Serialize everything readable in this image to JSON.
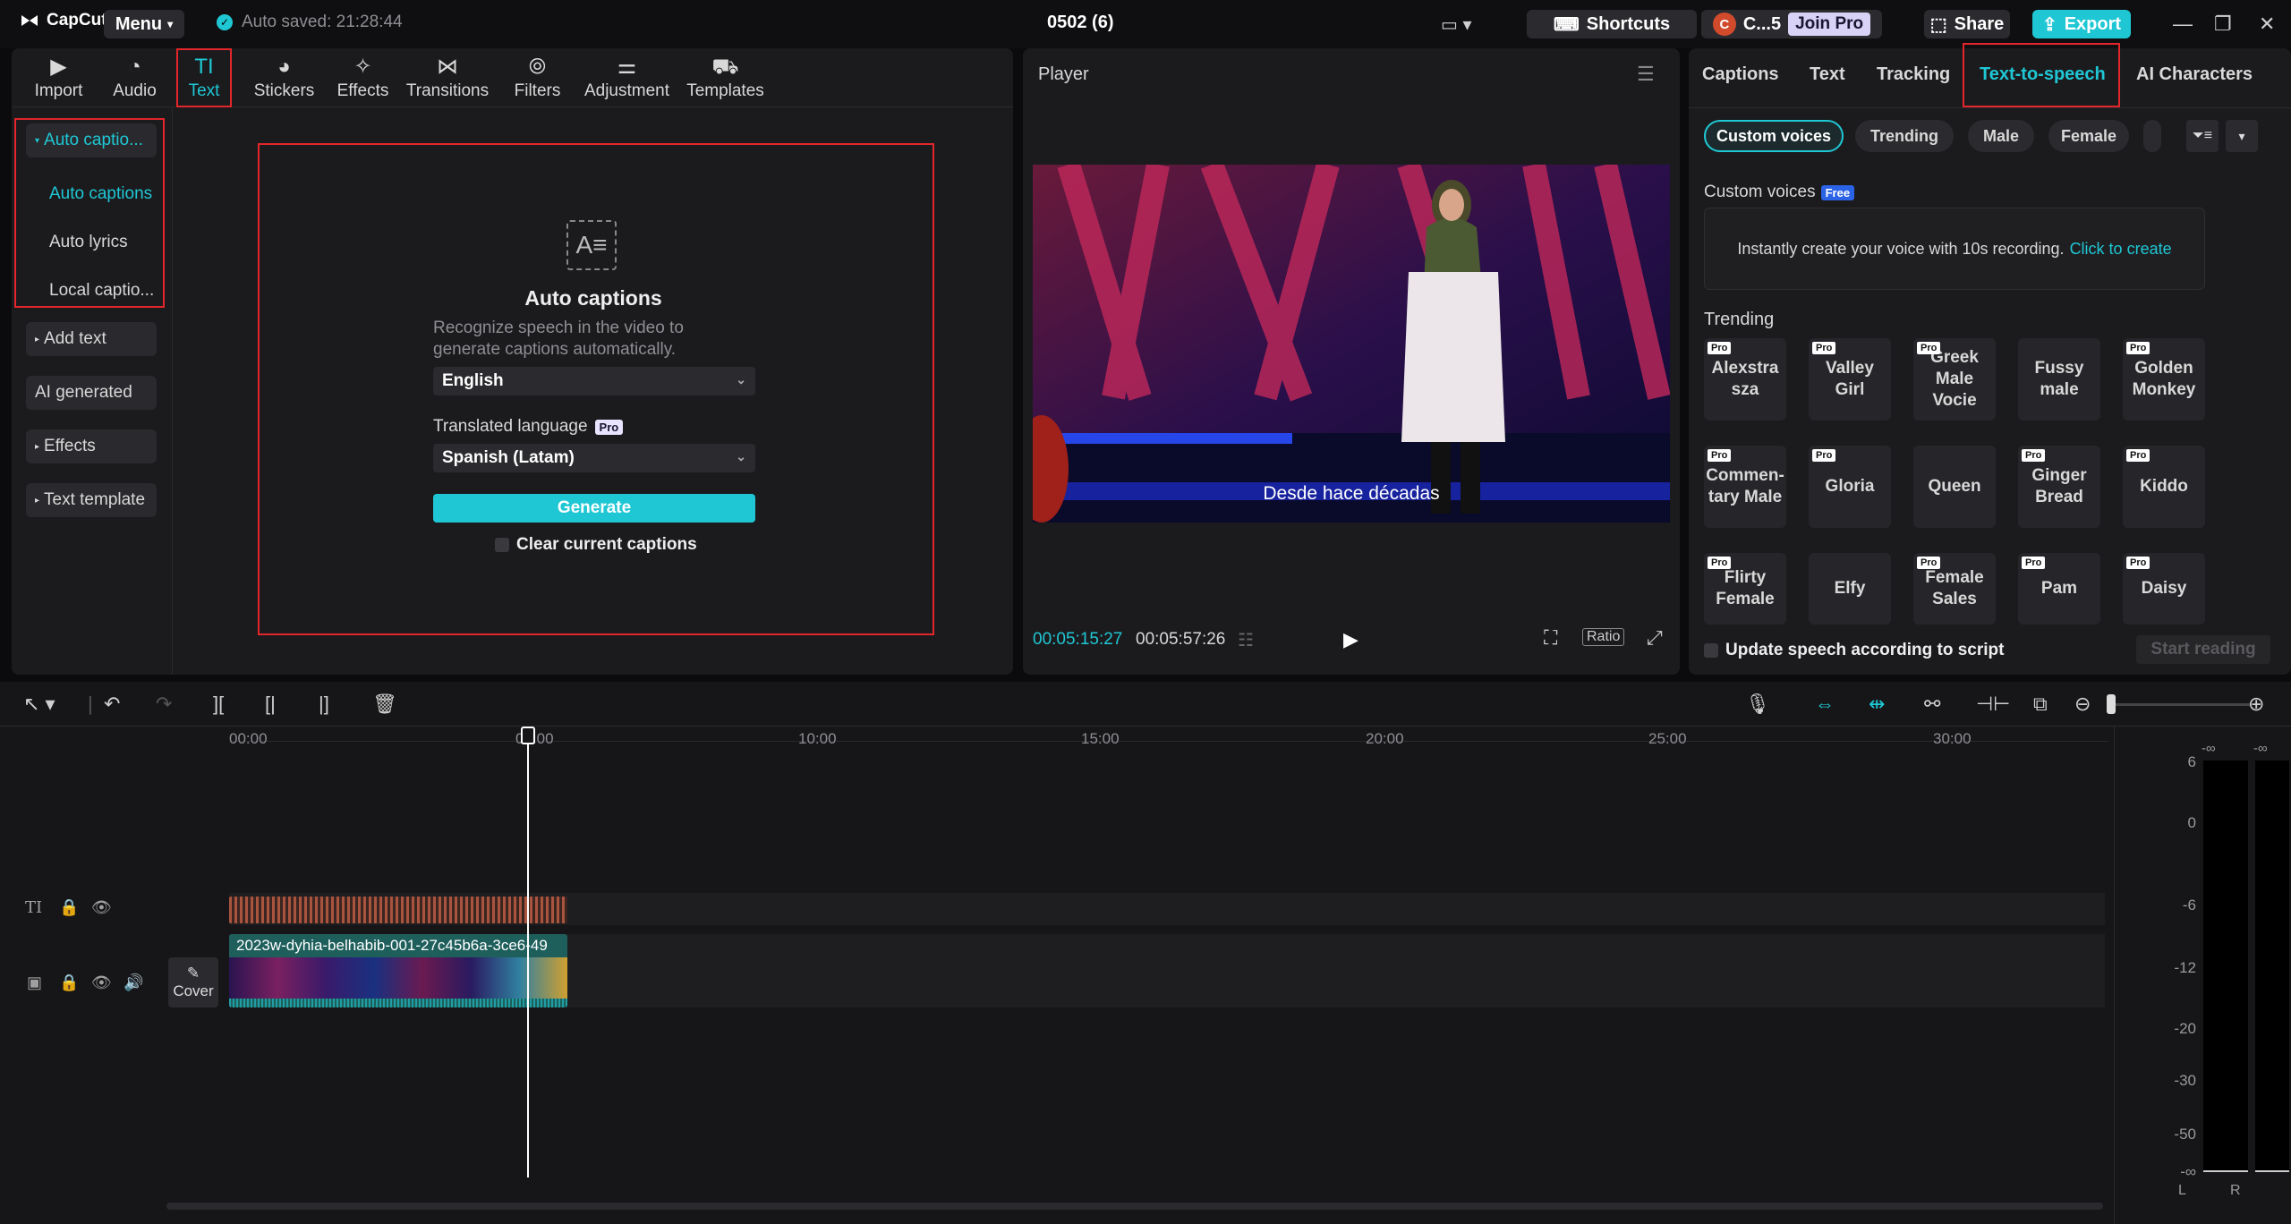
{
  "app": {
    "logo": "CapCut",
    "menu": "Menu",
    "autosave": "Auto saved: 21:28:44",
    "project_title": "0502 (6)",
    "shortcuts": "Shortcuts",
    "account": "C...5",
    "account_initial": "C",
    "join_pro": "Join Pro",
    "share": "Share",
    "export": "Export"
  },
  "toolbar": [
    {
      "label": "Import",
      "icon": "import-icon"
    },
    {
      "label": "Audio",
      "icon": "audio-icon"
    },
    {
      "label": "Text",
      "icon": "text-icon"
    },
    {
      "label": "Stickers",
      "icon": "stickers-icon"
    },
    {
      "label": "Effects",
      "icon": "effects-icon"
    },
    {
      "label": "Transitions",
      "icon": "transitions-icon"
    },
    {
      "label": "Filters",
      "icon": "filters-icon"
    },
    {
      "label": "Adjustment",
      "icon": "adjustment-icon"
    },
    {
      "label": "Templates",
      "icon": "templates-icon"
    }
  ],
  "sidebar": {
    "group": "Auto captio...",
    "sub": [
      "Auto captions",
      "Auto lyrics",
      "Local captio..."
    ],
    "items": [
      "Add text",
      "AI generated",
      "Effects",
      "Text template"
    ]
  },
  "auto_captions": {
    "title": "Auto captions",
    "desc1": "Recognize speech in the video to",
    "desc2": "generate captions automatically.",
    "language": "English",
    "translated_label": "Translated language",
    "pro": "Pro",
    "translated_value": "Spanish (Latam)",
    "generate": "Generate",
    "clear": "Clear current captions"
  },
  "player": {
    "title": "Player",
    "subtitle": "Desde hace décadas",
    "current_time": "00:05:15:27",
    "total_time": "00:05:57:26",
    "ratio": "Ratio"
  },
  "right_panel": {
    "tabs": [
      "Captions",
      "Text",
      "Tracking",
      "Text-to-speech",
      "AI Characters"
    ],
    "chips": [
      "Custom voices",
      "Trending",
      "Male",
      "Female"
    ],
    "custom_voices_label": "Custom voices",
    "free_badge": "Free",
    "custom_prompt": "Instantly create your voice with 10s recording.",
    "click_to_create": "Click to create",
    "trending_label": "Trending",
    "voices": [
      {
        "name": "Alexstra sza",
        "pro": true
      },
      {
        "name": "Valley Girl",
        "pro": true
      },
      {
        "name": "Greek Male Vocie",
        "pro": true
      },
      {
        "name": "Fussy male",
        "pro": false
      },
      {
        "name": "Golden Monkey",
        "pro": true
      },
      {
        "name": "Commen-tary Male",
        "pro": true
      },
      {
        "name": "Gloria",
        "pro": true
      },
      {
        "name": "Queen",
        "pro": false
      },
      {
        "name": "Ginger Bread",
        "pro": true
      },
      {
        "name": "Kiddo",
        "pro": true
      },
      {
        "name": "Flirty Female",
        "pro": true
      },
      {
        "name": "Elfy",
        "pro": false
      },
      {
        "name": "Female Sales",
        "pro": true
      },
      {
        "name": "Pam",
        "pro": true
      },
      {
        "name": "Daisy",
        "pro": true
      }
    ],
    "pro_tag": "Pro",
    "update_speech": "Update speech according to script",
    "start_reading": "Start reading"
  },
  "timeline": {
    "ruler": [
      "00:00",
      "05:00",
      "10:00",
      "15:00",
      "20:00",
      "25:00",
      "30:00"
    ],
    "clip_name": "2023w-dyhia-belhabib-001-27c45b6a-3ce6-49",
    "cover": "Cover",
    "meter_db": [
      "6",
      "0",
      "-6",
      "-12",
      "-20",
      "-30",
      "-50",
      "-∞"
    ],
    "meter_top": [
      "-∞",
      "-∞"
    ],
    "meter_channels": [
      "L",
      "R"
    ]
  },
  "colors": {
    "accent": "#1fc7d4",
    "highlight_box": "#e2262b"
  }
}
